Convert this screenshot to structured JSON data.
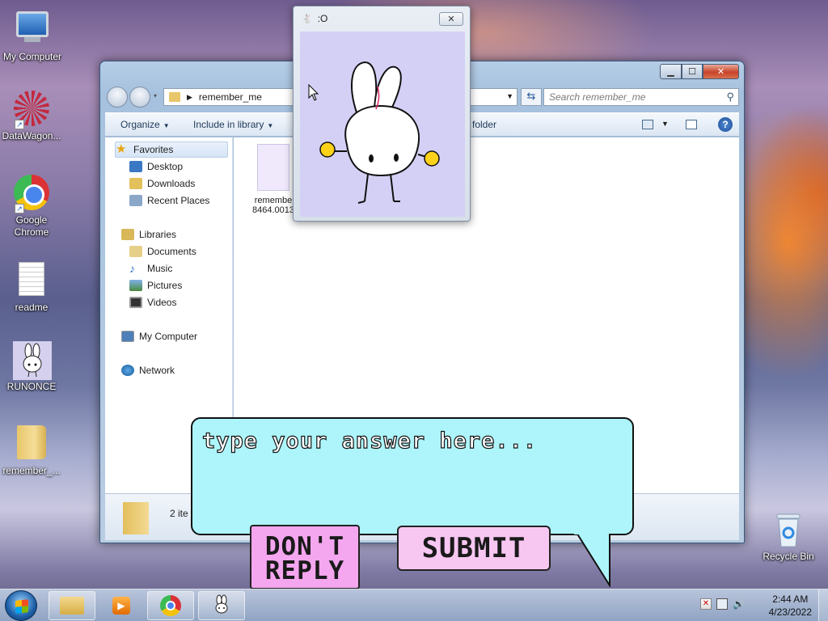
{
  "desktop": {
    "icons": [
      {
        "label": "My Computer",
        "icon": "my-computer-icon"
      },
      {
        "label": "DataWagon...",
        "icon": "datawagon-icon"
      },
      {
        "label": "Google\nChrome",
        "icon": "chrome-icon"
      },
      {
        "label": "readme",
        "icon": "text-document-icon"
      },
      {
        "label": "RUNONCE",
        "icon": "bunny-icon"
      },
      {
        "label": "remember_...",
        "icon": "folder-icon"
      },
      {
        "label": "Recycle Bin",
        "icon": "recycle-bin-icon"
      }
    ]
  },
  "explorer": {
    "address_folder": "remember_me",
    "search_placeholder": "Search remember_me",
    "toolbar": {
      "organize": "Organize",
      "include_in_library": "Include in library",
      "new_folder": "folder"
    },
    "nav": {
      "favorites": "Favorites",
      "favorites_items": [
        "Desktop",
        "Downloads",
        "Recent Places"
      ],
      "libraries": "Libraries",
      "libraries_items": [
        "Documents",
        "Music",
        "Pictures",
        "Videos"
      ],
      "computer": "My Computer",
      "network": "Network"
    },
    "file": {
      "name_line1": "remembe",
      "name_line2": "8464.0013"
    },
    "details_text": "2 ite"
  },
  "bunny_window": {
    "title": ":O"
  },
  "dialog": {
    "answer_placeholder": "type your answer here...",
    "dont_reply_label": "DON'T REPLY",
    "submit_label": "SUBMIT"
  },
  "taskbar": {
    "time": "2:44 AM",
    "date": "4/23/2022"
  },
  "colors": {
    "speech_bubble": "#adf5fa",
    "dont_reply_button": "#f4a6ef",
    "submit_button": "#f7c7f2",
    "bunny_bg": "#d4d0f5"
  }
}
